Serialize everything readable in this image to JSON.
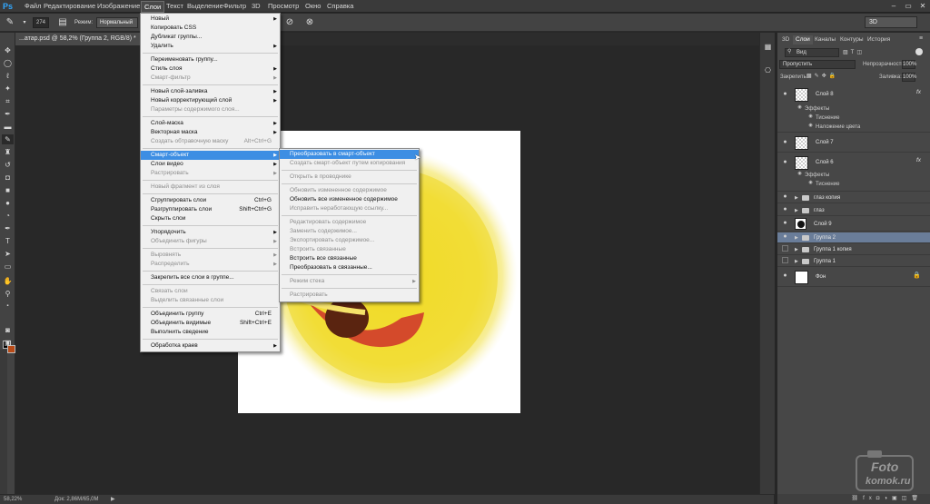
{
  "app": {
    "logo": "Ps"
  },
  "menubar": {
    "items": [
      "Файл",
      "Редактирование",
      "Изображение",
      "Слои",
      "Текст",
      "Выделение",
      "Фильтр",
      "3D",
      "Просмотр",
      "Окно",
      "Справка"
    ]
  },
  "options": {
    "brush_size": "274",
    "mode_label": "Режим:",
    "mode_value": "Нормальный",
    "workspace": "3D"
  },
  "document": {
    "tab_title": "...атар.psd @ 58,2% (Группа 2, RGB/8) *"
  },
  "status": {
    "zoom": "58,22%",
    "doc_size": "Док: 2,86M/65,0M"
  },
  "layer_menu": {
    "items": [
      {
        "label": "Новый",
        "shortcut": "",
        "submenu": true,
        "disabled": false
      },
      {
        "label": "Копировать CSS",
        "shortcut": "",
        "submenu": false,
        "disabled": false
      },
      {
        "label": "Дубликат группы...",
        "shortcut": "",
        "submenu": false,
        "disabled": false
      },
      {
        "label": "Удалить",
        "shortcut": "",
        "submenu": true,
        "disabled": false
      },
      {
        "label": "Переименовать группу...",
        "shortcut": "",
        "submenu": false,
        "disabled": false
      },
      {
        "label": "Стиль слоя",
        "shortcut": "",
        "submenu": true,
        "disabled": false
      },
      {
        "label": "Смарт-фильтр",
        "shortcut": "",
        "submenu": true,
        "disabled": true
      },
      {
        "label": "Новый слой-заливка",
        "shortcut": "",
        "submenu": true,
        "disabled": false
      },
      {
        "label": "Новый корректирующий слой",
        "shortcut": "",
        "submenu": true,
        "disabled": false
      },
      {
        "label": "Параметры содержимого слоя...",
        "shortcut": "",
        "submenu": false,
        "disabled": true
      },
      {
        "label": "Слой-маска",
        "shortcut": "",
        "submenu": true,
        "disabled": false
      },
      {
        "label": "Векторная маска",
        "shortcut": "",
        "submenu": true,
        "disabled": false
      },
      {
        "label": "Создать обтравочную маску",
        "shortcut": "Alt+Ctrl+G",
        "submenu": false,
        "disabled": true
      },
      {
        "label": "Смарт-объект",
        "shortcut": "",
        "submenu": true,
        "disabled": false,
        "highlighted": true
      },
      {
        "label": "Слои видео",
        "shortcut": "",
        "submenu": true,
        "disabled": false
      },
      {
        "label": "Растрировать",
        "shortcut": "",
        "submenu": true,
        "disabled": true
      },
      {
        "label": "Новый фрагмент из слоя",
        "shortcut": "",
        "submenu": false,
        "disabled": true
      },
      {
        "label": "Сгруппировать слои",
        "shortcut": "Ctrl+G",
        "submenu": false,
        "disabled": false
      },
      {
        "label": "Разгруппировать слои",
        "shortcut": "Shift+Ctrl+G",
        "submenu": false,
        "disabled": false
      },
      {
        "label": "Скрыть слои",
        "shortcut": "",
        "submenu": false,
        "disabled": false
      },
      {
        "label": "Упорядочить",
        "shortcut": "",
        "submenu": true,
        "disabled": false
      },
      {
        "label": "Объединить фигуры",
        "shortcut": "",
        "submenu": true,
        "disabled": true
      },
      {
        "label": "Выровнять",
        "shortcut": "",
        "submenu": true,
        "disabled": true
      },
      {
        "label": "Распределить",
        "shortcut": "",
        "submenu": true,
        "disabled": true
      },
      {
        "label": "Закрепить все слои в группе...",
        "shortcut": "",
        "submenu": false,
        "disabled": false
      },
      {
        "label": "Связать слои",
        "shortcut": "",
        "submenu": false,
        "disabled": true
      },
      {
        "label": "Выделить связанные слои",
        "shortcut": "",
        "submenu": false,
        "disabled": true
      },
      {
        "label": "Объединить группу",
        "shortcut": "Ctrl+E",
        "submenu": false,
        "disabled": false
      },
      {
        "label": "Объединить видимые",
        "shortcut": "Shift+Ctrl+E",
        "submenu": false,
        "disabled": false
      },
      {
        "label": "Выполнить сведение",
        "shortcut": "",
        "submenu": false,
        "disabled": false
      },
      {
        "label": "Обработка краев",
        "shortcut": "",
        "submenu": true,
        "disabled": false
      }
    ]
  },
  "smart_menu": {
    "items": [
      {
        "label": "Преобразовать в смарт-объект",
        "disabled": false,
        "highlighted": true
      },
      {
        "label": "Создать смарт-объект путем копирования",
        "disabled": true
      },
      {
        "label": "Открыть в проводнике",
        "disabled": true
      },
      {
        "label": "Обновить измененное содержимое",
        "disabled": true
      },
      {
        "label": "Обновить все измененное содержимое",
        "disabled": false
      },
      {
        "label": "Исправить неработающую ссылку...",
        "disabled": true
      },
      {
        "label": "Редактировать содержимое",
        "disabled": true
      },
      {
        "label": "Заменить содержимое...",
        "disabled": true
      },
      {
        "label": "Экспортировать содержимое...",
        "disabled": true
      },
      {
        "label": "Встроить связанные",
        "disabled": true
      },
      {
        "label": "Встроить все связанные",
        "disabled": false
      },
      {
        "label": "Преобразовать в связанные...",
        "disabled": false
      },
      {
        "label": "Режим стека",
        "disabled": true,
        "submenu": true
      },
      {
        "label": "Растрировать",
        "disabled": true
      }
    ]
  },
  "panel": {
    "tabs": [
      "3D",
      "Слои",
      "Каналы",
      "Контуры",
      "История"
    ],
    "filter": "Вид",
    "blend_mode": "Пропустить",
    "opacity_label": "Непрозрачность:",
    "opacity": "100%",
    "lock_label": "Закрепить:",
    "fill_label": "Заливка:",
    "fill": "100%",
    "layers": [
      {
        "name": "Слой 8",
        "type": "layer",
        "fx": true,
        "thumb": "checker",
        "effects_label": "Эффекты",
        "effects": [
          "Тиснение",
          "Наложение цвета"
        ]
      },
      {
        "name": "Слой 7",
        "type": "layer",
        "fx": false,
        "thumb": "checker"
      },
      {
        "name": "Слой 6",
        "type": "layer",
        "fx": true,
        "thumb": "checker",
        "effects_label": "Эффекты",
        "effects": [
          "Тиснение"
        ]
      },
      {
        "name": "глаз копия",
        "type": "group"
      },
      {
        "name": "глаз",
        "type": "group"
      },
      {
        "name": "Слой 9",
        "type": "layer",
        "fx": false,
        "thumb": "dark"
      },
      {
        "name": "Группа 2",
        "type": "group",
        "selected": true
      },
      {
        "name": "Группа 1 копия",
        "type": "group"
      },
      {
        "name": "Группа 1",
        "type": "group"
      },
      {
        "name": "Фон",
        "type": "background",
        "thumb": "white",
        "locked": true
      }
    ]
  },
  "watermark": {
    "line1": "Foto",
    "line2": "komok.ru"
  }
}
